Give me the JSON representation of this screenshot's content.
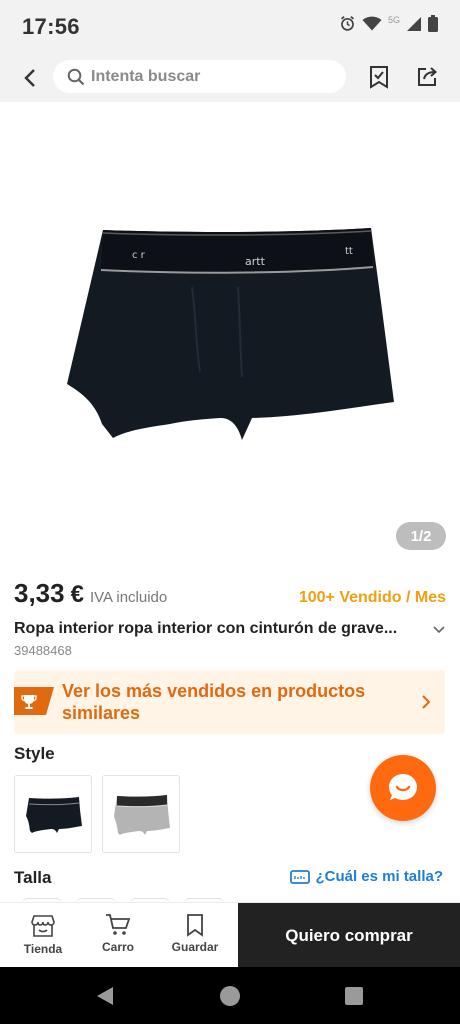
{
  "status_bar": {
    "time": "17:56",
    "network": "5G"
  },
  "header": {
    "search_placeholder": "Intenta buscar"
  },
  "gallery": {
    "counter": "1/2",
    "brand_print": "artt"
  },
  "product": {
    "price": "3,33",
    "currency": "€",
    "vat_label": "IVA incluido",
    "sold_label": "100+ Vendido / Mes",
    "title": "Ropa interior ropa interior con cinturón de grave...",
    "id": "39488468"
  },
  "bestseller_banner": {
    "text": "Ver los más vendidos en productos similares"
  },
  "style_section": {
    "label": "Style",
    "options": [
      "black",
      "gray"
    ]
  },
  "size_section": {
    "label": "Talla",
    "guide_label": "¿Cuál es mi talla?"
  },
  "bottom_bar": {
    "shop_label": "Tienda",
    "cart_label": "Carro",
    "save_label": "Guardar",
    "buy_label": "Quiero comprar"
  },
  "colors": {
    "accent_orange": "#ff6a10",
    "sold_orange": "#f0a010",
    "link_blue": "#1e7fd6",
    "buy_button": "#222222"
  }
}
